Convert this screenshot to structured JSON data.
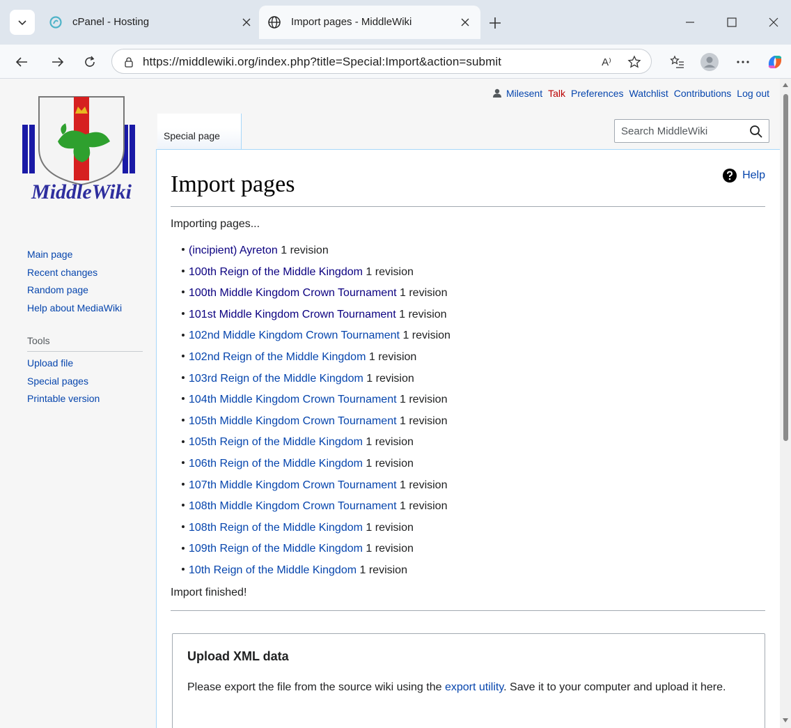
{
  "browser": {
    "tabs": [
      {
        "title": "cPanel - Hosting",
        "icon": "cpanel-icon"
      },
      {
        "title": "Import pages - MiddleWiki",
        "icon": "globe-icon"
      }
    ],
    "url": "https://middlewiki.org/index.php?title=Special:Import&action=submit",
    "read_aloud_label": "A⁾"
  },
  "wiki": {
    "logo_text": "MiddleWiki",
    "personal": {
      "username": "Milesent",
      "talk": "Talk",
      "preferences": "Preferences",
      "watchlist": "Watchlist",
      "contributions": "Contributions",
      "logout": "Log out"
    },
    "special_tab": "Special page",
    "search_placeholder": "Search MiddleWiki",
    "sidebar": {
      "nav": [
        "Main page",
        "Recent changes",
        "Random page",
        "Help about MediaWiki"
      ],
      "tools_heading": "Tools",
      "tools": [
        "Upload file",
        "Special pages",
        "Printable version"
      ]
    },
    "title": "Import pages",
    "help": "Help",
    "importing": "Importing pages...",
    "revision_text": "1 revision",
    "pages": [
      "(incipient) Ayreton",
      "100th Reign of the Middle Kingdom",
      "100th Middle Kingdom Crown Tournament",
      "101st Middle Kingdom Crown Tournament",
      "102nd Middle Kingdom Crown Tournament",
      "102nd Reign of the Middle Kingdom",
      "103rd Reign of the Middle Kingdom",
      "104th Middle Kingdom Crown Tournament",
      "105th Middle Kingdom Crown Tournament",
      "105th Reign of the Middle Kingdom",
      "106th Reign of the Middle Kingdom",
      "107th Middle Kingdom Crown Tournament",
      "108th Middle Kingdom Crown Tournament",
      "108th Reign of the Middle Kingdom",
      "109th Reign of the Middle Kingdom",
      "10th Reign of the Middle Kingdom"
    ],
    "finished": "Import finished!",
    "upload": {
      "heading": "Upload XML data",
      "text_before": "Please export the file from the source wiki using the ",
      "link": "export utility",
      "text_after": ". Save it to your computer and upload it here."
    }
  }
}
